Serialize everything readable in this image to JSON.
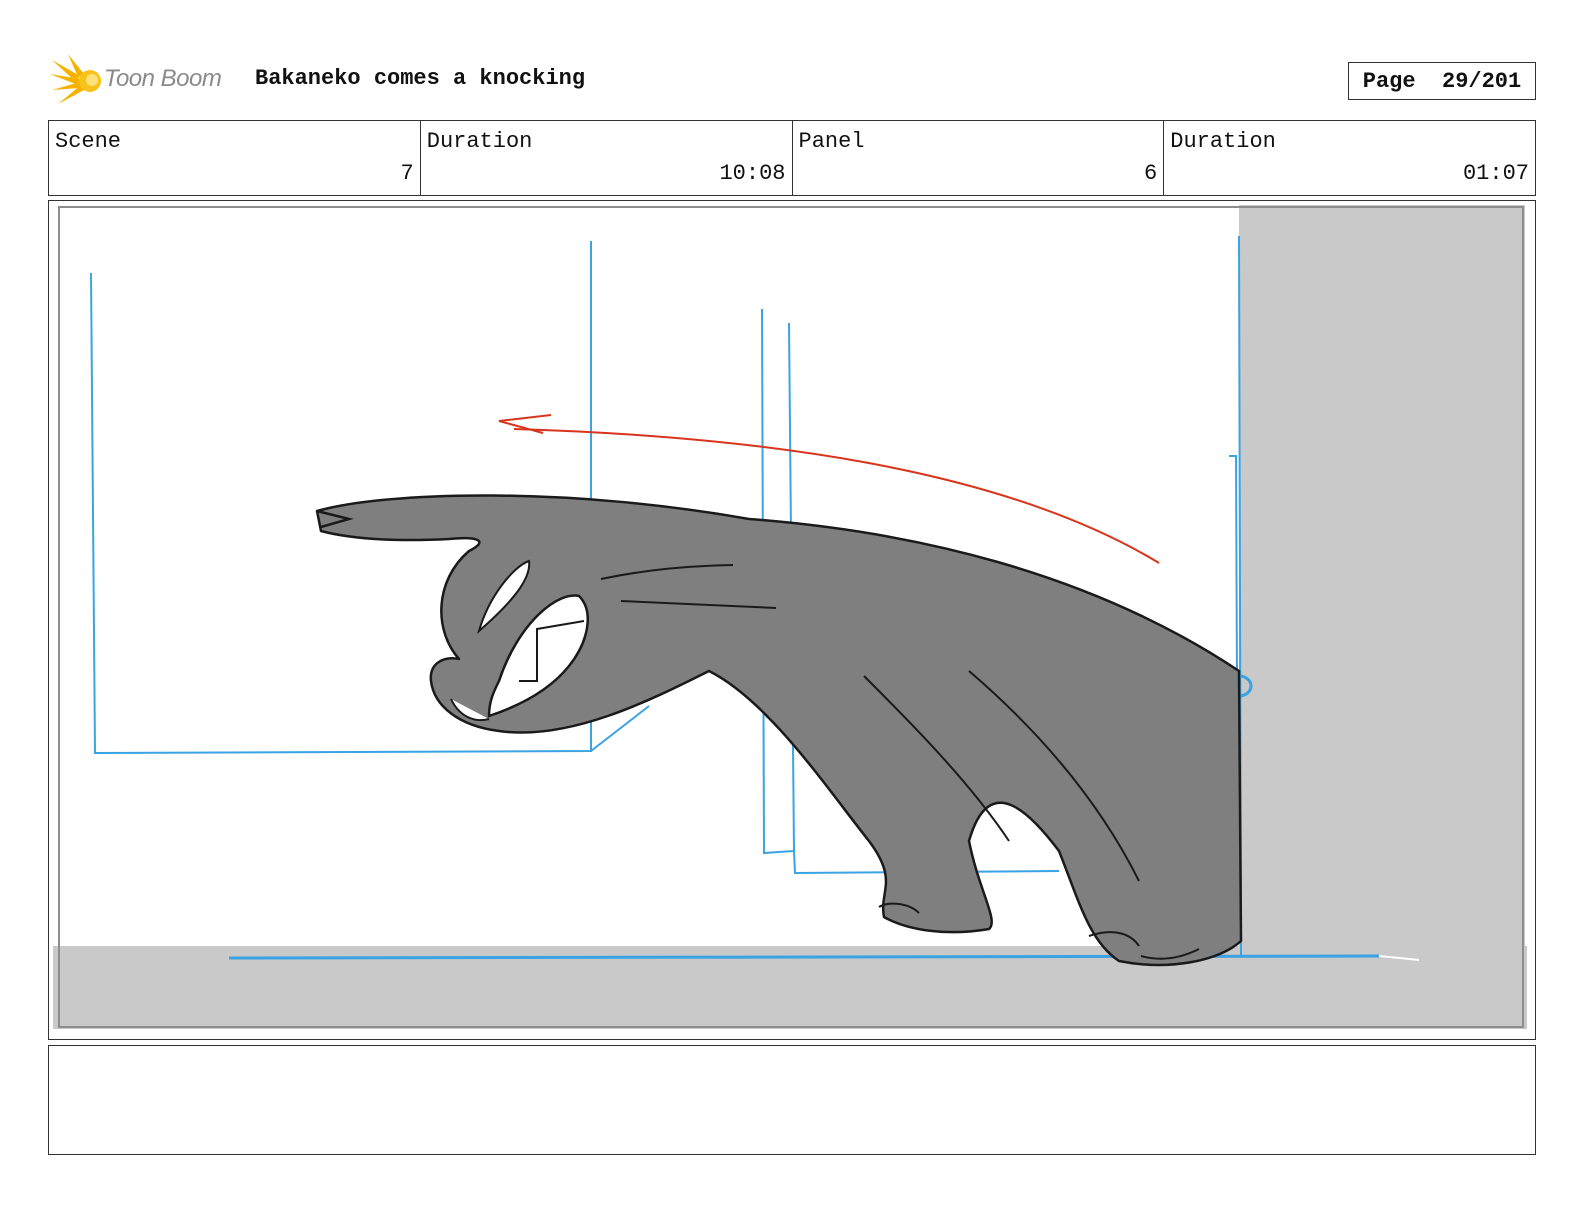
{
  "header": {
    "logo_text": "Toon Boom",
    "title": "Bakaneko comes a knocking",
    "page": "Page  29/201"
  },
  "info": {
    "scene_label": "Scene",
    "scene_value": "7",
    "scene_duration_label": "Duration",
    "scene_duration_value": "10:08",
    "panel_label": "Panel",
    "panel_value": "6",
    "panel_duration_label": "Duration",
    "panel_duration_value": "01:07"
  },
  "notes": {
    "text": ""
  },
  "colors": {
    "layout_lines": "#3aa3e3",
    "action_arrow": "#d9341c",
    "character_fill": "#7f7f7f",
    "wall_fill": "#c9c9c9"
  }
}
